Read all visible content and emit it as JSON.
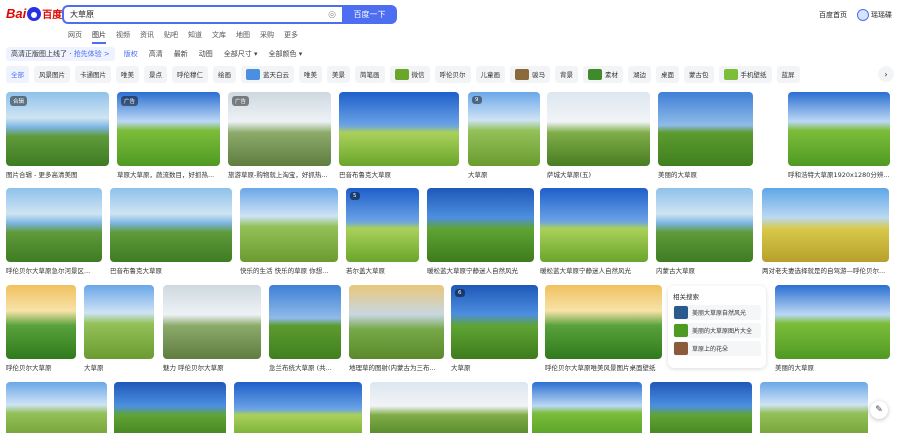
{
  "logo": {
    "text_bai": "Bai",
    "text_du": "百度"
  },
  "search": {
    "value": "大草原",
    "button": "百度一下",
    "camera_icon": "camera-icon"
  },
  "header": {
    "home": "百度首页",
    "user": "瑶瑶碟"
  },
  "tabs": [
    {
      "label": "网页"
    },
    {
      "label": "图片"
    },
    {
      "label": "视频"
    },
    {
      "label": "资讯"
    },
    {
      "label": "贴吧"
    },
    {
      "label": "知道"
    },
    {
      "label": "文库"
    },
    {
      "label": "地图"
    },
    {
      "label": "采购"
    },
    {
      "label": "更多"
    }
  ],
  "filters": {
    "notice_text": "高清正版图上线了 · ",
    "notice_link": "抢先体验 >",
    "items": [
      "版权",
      "高清",
      "最新",
      "动图",
      "全部尺寸",
      "全部颜色"
    ]
  },
  "categories": [
    {
      "label": "全部",
      "thumb": false
    },
    {
      "label": "风景图片",
      "thumb": false
    },
    {
      "label": "卡通图片",
      "thumb": false
    },
    {
      "label": "唯美",
      "thumb": false
    },
    {
      "label": "景点",
      "thumb": false
    },
    {
      "label": "呼伦穆仁",
      "thumb": false
    },
    {
      "label": "绘画",
      "thumb": false
    },
    {
      "label": "蓝天白云",
      "thumb": true,
      "color": "#4a8fe0"
    },
    {
      "label": "唯美",
      "thumb": false
    },
    {
      "label": "美景",
      "thumb": false
    },
    {
      "label": "简笔画",
      "thumb": false
    },
    {
      "label": "微信",
      "thumb": true,
      "color": "#6aa52c"
    },
    {
      "label": "呼伦贝尔",
      "thumb": false
    },
    {
      "label": "儿童画",
      "thumb": false
    },
    {
      "label": "骏马",
      "thumb": true,
      "color": "#8a6a3a"
    },
    {
      "label": "背景",
      "thumb": false
    },
    {
      "label": "素材",
      "thumb": true,
      "color": "#3f8a2a"
    },
    {
      "label": "湖边",
      "thumb": false
    },
    {
      "label": "桌面",
      "thumb": false
    },
    {
      "label": "蒙古包",
      "thumb": false
    },
    {
      "label": "手机壁纸",
      "thumb": true,
      "color": "#7cbd3a"
    },
    {
      "label": "蓝屏",
      "thumb": false
    }
  ],
  "images": [
    {
      "caption": "图片合辑 - 更多高清美图",
      "badge": "合辑",
      "style": "lake"
    },
    {
      "caption": "草原大草原，蔬流数目，好抓热...",
      "badge": "广告",
      "style": "sky2"
    },
    {
      "caption": "旅游草原-购物就上淘宝，好抓热...",
      "badge": "广告",
      "style": "sky3"
    },
    {
      "caption": "巴音布鲁克大草原",
      "badge": "",
      "style": "sky4"
    },
    {
      "caption": "大草原",
      "badge": "9",
      "style": "sky5"
    },
    {
      "caption": "萨城大草原(五)",
      "badge": "",
      "style": "sky6"
    },
    {
      "caption": "美丽的大草原",
      "badge": "",
      "style": "sky1"
    },
    {
      "caption": "呼和浩特大草原1920x1280分辨...",
      "badge": "",
      "style": "sky2"
    },
    {
      "caption": "呼伦贝尔大草原急尔河景区...",
      "badge": "",
      "style": "lake"
    },
    {
      "caption": "巴音布鲁克大草原",
      "badge": "",
      "style": "lake"
    },
    {
      "caption": "快乐的生活 快乐的草原 你想...",
      "badge": "",
      "style": "sky5"
    },
    {
      "caption": "若尔盖大草原",
      "badge": "5",
      "style": "sky4"
    },
    {
      "caption": "暖松蓝大草原宁静迷人自然风光",
      "badge": "",
      "style": "sky7"
    },
    {
      "caption": "暖松蓝大草原宁静迷人自然风光",
      "badge": "",
      "style": "sky4"
    },
    {
      "caption": "内蒙古大草原",
      "badge": "",
      "style": "lake"
    },
    {
      "caption": "两对老夫妻选择就是的自驾游—呼伦贝尔...",
      "badge": "",
      "style": "yellow"
    },
    {
      "caption": "呼伦贝尔大草原",
      "badge": "",
      "style": "sky8"
    },
    {
      "caption": "大草原",
      "badge": "",
      "style": "sky5"
    },
    {
      "caption": "魅力 呼伦贝尔大草原",
      "badge": "",
      "style": "sky3"
    },
    {
      "caption": "急兰布统大草原 (共...",
      "badge": "",
      "style": "sky1"
    },
    {
      "caption": "地理草的图射(内蒙古为三布...",
      "badge": "",
      "style": "sky9"
    },
    {
      "caption": "大草原",
      "badge": "6",
      "style": "sky7"
    },
    {
      "caption": "呼伦贝尔大草原唯美风景图片桌面壁纸",
      "badge": "",
      "style": "sky8"
    },
    {
      "caption": "美丽的大草原",
      "badge": "",
      "style": "sky2"
    },
    {
      "caption": "",
      "badge": "",
      "style": "sky5"
    },
    {
      "caption": "",
      "badge": "",
      "style": "sky7"
    },
    {
      "caption": "",
      "badge": "",
      "style": "sky4"
    },
    {
      "caption": "",
      "badge": "",
      "style": "sky6"
    },
    {
      "caption": "",
      "badge": "",
      "style": "sky2"
    },
    {
      "caption": "",
      "badge": "",
      "style": "sky7"
    },
    {
      "caption": "",
      "badge": "",
      "style": "sky5"
    },
    {
      "caption": "",
      "badge": "",
      "style": "yellow"
    }
  ],
  "related": {
    "title": "相关搜索",
    "items": [
      {
        "label": "美丽大草原自然风光",
        "color": "#2c5a8c"
      },
      {
        "label": "美丽的大草原图片大全",
        "color": "#4f9a23"
      },
      {
        "label": "草原上的花朵",
        "color": "#8a5a3a"
      }
    ]
  },
  "float_icon": "edit-icon"
}
